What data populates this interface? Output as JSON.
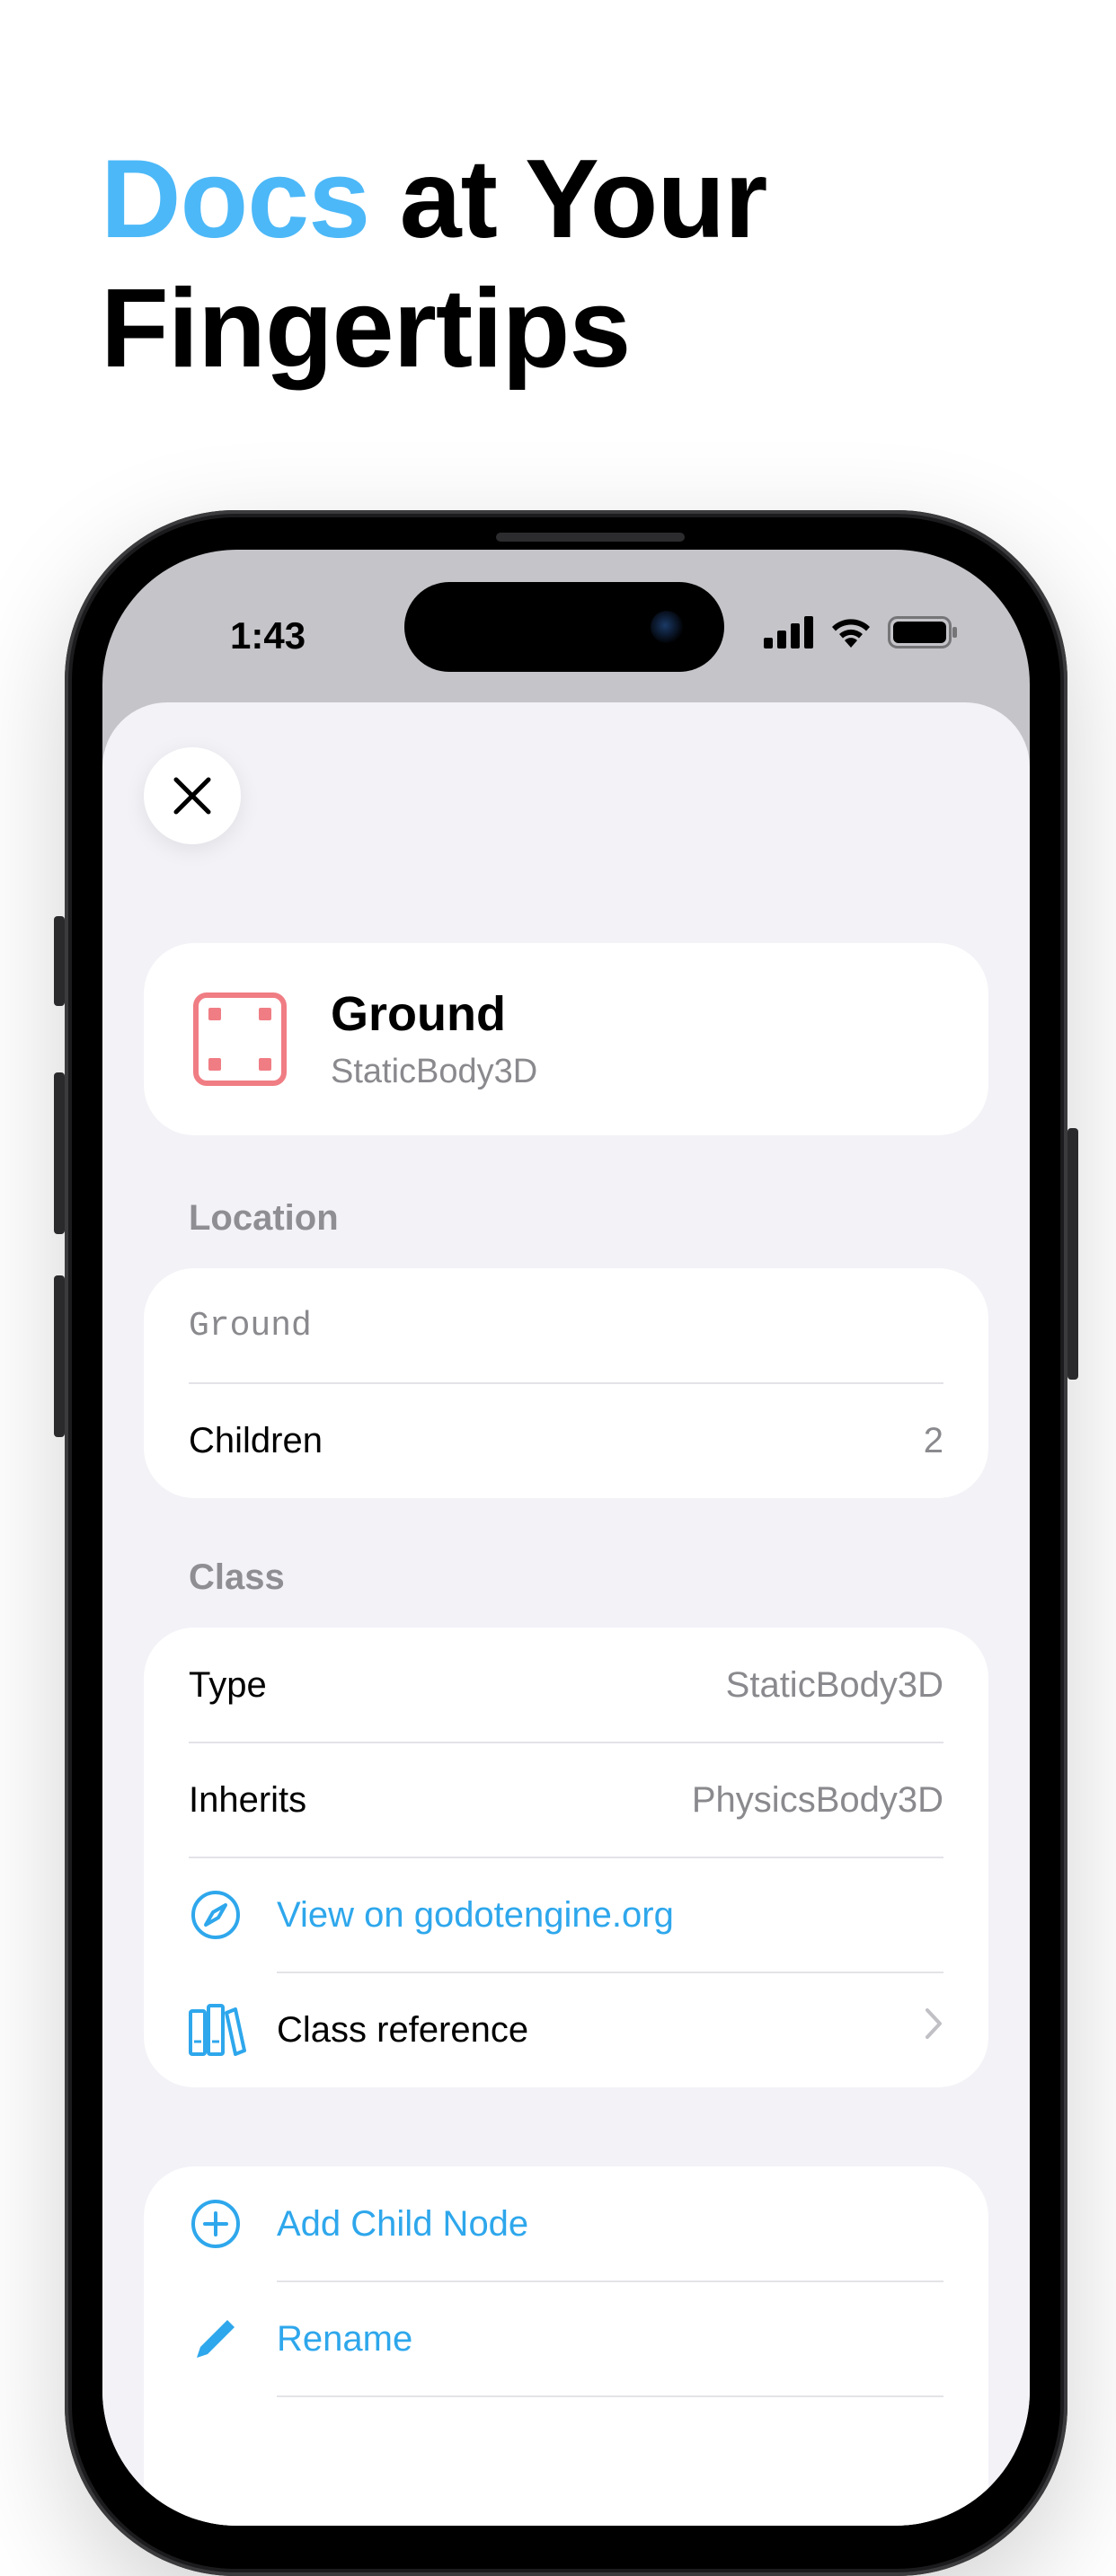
{
  "headline": {
    "accent": "Docs",
    "rest_line1": " at Your",
    "line2": "Fingertips"
  },
  "status_bar": {
    "time": "1:43"
  },
  "node": {
    "name": "Ground",
    "class": "StaticBody3D"
  },
  "location": {
    "section_label": "Location",
    "path": "Ground",
    "children_label": "Children",
    "children_count": "2"
  },
  "class_section": {
    "section_label": "Class",
    "type_label": "Type",
    "type_value": "StaticBody3D",
    "inherits_label": "Inherits",
    "inherits_value": "PhysicsBody3D",
    "web_link_label": "View on godotengine.org",
    "class_reference_label": "Class reference"
  },
  "actions": {
    "add_child_label": "Add Child Node",
    "rename_label": "Rename"
  },
  "colors": {
    "accent": "#4cb8f8",
    "link": "#2ea7ec",
    "node_icon": "#f07d84",
    "sheet_background": "#f2f2f7"
  },
  "icons": [
    "close-icon",
    "static-body-icon",
    "compass-icon",
    "books-icon",
    "chevron-right-icon",
    "plus-circle-icon",
    "pencil-icon",
    "cellular-icon",
    "wifi-icon",
    "battery-icon"
  ]
}
